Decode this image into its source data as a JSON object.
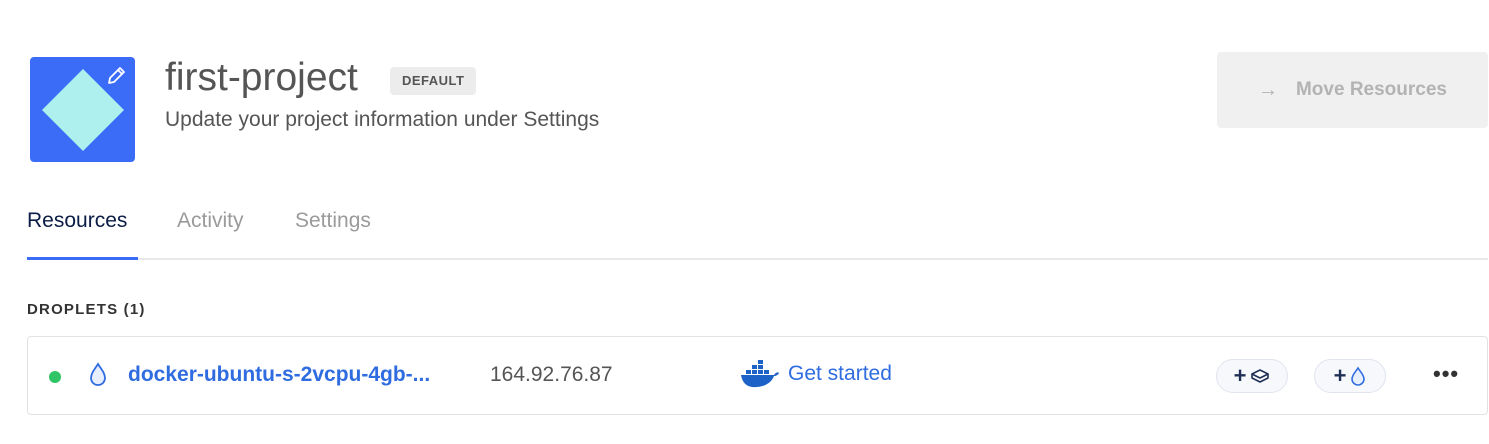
{
  "project": {
    "name": "first-project",
    "badge": "DEFAULT",
    "subtitle": "Update your project information under Settings"
  },
  "header": {
    "move_button_label": "Move Resources"
  },
  "tabs": [
    {
      "label": "Resources",
      "active": true
    },
    {
      "label": "Activity",
      "active": false
    },
    {
      "label": "Settings",
      "active": false
    }
  ],
  "droplets": {
    "heading": "DROPLETS (1)",
    "rows": [
      {
        "status": "running",
        "name": "docker-ubuntu-s-2vcpu-4gb-...",
        "ip": "164.92.76.87",
        "app_link": "Get started"
      }
    ]
  },
  "colors": {
    "accent": "#3a6cf7",
    "link": "#2f6ce0",
    "status_running": "#2fc466"
  }
}
